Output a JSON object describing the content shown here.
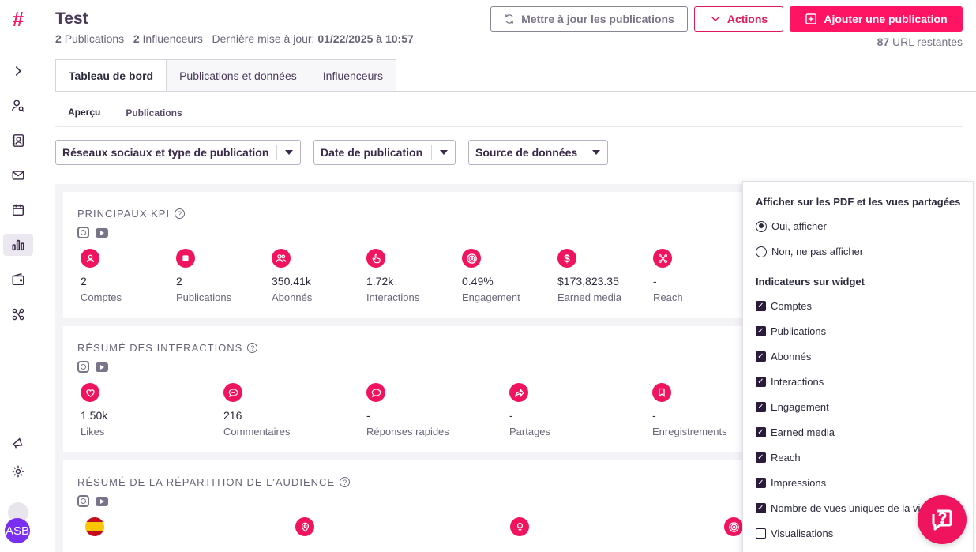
{
  "app": {
    "logo_glyph": "#",
    "brand_color": "#ff1464"
  },
  "sidebar": {
    "items": [
      {
        "name": "expand-icon"
      },
      {
        "name": "user-search-icon"
      },
      {
        "name": "contacts-icon"
      },
      {
        "name": "mail-icon"
      },
      {
        "name": "calendar-icon"
      },
      {
        "name": "bar-chart-icon",
        "active": true
      },
      {
        "name": "wallet-icon"
      },
      {
        "name": "network-icon"
      },
      {
        "name": "megaphone-icon"
      },
      {
        "name": "settings-icon"
      }
    ],
    "avatar_initials": "ASB"
  },
  "header": {
    "title": "Test",
    "publications_count": "2",
    "publications_label": "Publications",
    "influencers_count": "2",
    "influencers_label": "Influenceurs",
    "last_update_label": "Dernière mise à jour:",
    "last_update_value": "01/22/2025 à 10:57",
    "update_button": "Mettre à jour les publications",
    "actions_button": "Actions",
    "add_button": "Ajouter une publication",
    "urls_left_count": "87",
    "urls_left_label": "URL restantes"
  },
  "tabs": [
    {
      "label": "Tableau de bord",
      "active": true
    },
    {
      "label": "Publications et données"
    },
    {
      "label": "Influenceurs"
    }
  ],
  "subtabs": [
    {
      "label": "Aperçu",
      "active": true
    },
    {
      "label": "Publications"
    }
  ],
  "filters": [
    {
      "label": "Réseaux sociaux et type de publication"
    },
    {
      "label": "Date de publication"
    },
    {
      "label": "Source de données"
    }
  ],
  "kpi_card": {
    "title": "PRINCIPAUX KPI",
    "metrics": [
      {
        "icon": "user-icon",
        "value": "2",
        "label": "Comptes"
      },
      {
        "icon": "square-icon",
        "value": "2",
        "label": "Publications"
      },
      {
        "icon": "users-icon",
        "value": "350.41k",
        "label": "Abonnés"
      },
      {
        "icon": "hand-pointer-icon",
        "value": "1.72k",
        "label": "Interactions"
      },
      {
        "icon": "target-icon",
        "value": "0.49%",
        "label": "Engagement"
      },
      {
        "icon": "dollar-icon",
        "value": "$173,823.35",
        "label": "Earned media"
      },
      {
        "icon": "reach-icon",
        "value": "-",
        "label": "Reach"
      }
    ]
  },
  "interactions_card": {
    "title": "RÉSUMÉ DES INTERACTIONS",
    "metrics": [
      {
        "icon": "heart-icon",
        "value": "1.50k",
        "label": "Likes"
      },
      {
        "icon": "comment-icon",
        "value": "216",
        "label": "Commentaires"
      },
      {
        "icon": "quick-reply-icon",
        "value": "-",
        "label": "Réponses rapides"
      },
      {
        "icon": "share-icon",
        "value": "-",
        "label": "Partages"
      },
      {
        "icon": "bookmark-icon",
        "value": "-",
        "label": "Enregistrements"
      }
    ]
  },
  "audience_card": {
    "title": "RÉSUMÉ DE LA RÉPARTITION DE L'AUDIENCE",
    "icons": [
      "spain-flag-icon",
      "location-pin-icon",
      "gender-female-icon",
      "target-icon"
    ]
  },
  "panel": {
    "pdf_heading": "Afficher sur les PDF et les vues partagées",
    "radio_yes": "Oui, afficher",
    "radio_no": "Non, ne pas afficher",
    "indicators_heading": "Indicateurs sur widget",
    "indicators": [
      {
        "label": "Comptes",
        "checked": true
      },
      {
        "label": "Publications",
        "checked": true
      },
      {
        "label": "Abonnés",
        "checked": true
      },
      {
        "label": "Interactions",
        "checked": true
      },
      {
        "label": "Engagement",
        "checked": true
      },
      {
        "label": "Earned media",
        "checked": true
      },
      {
        "label": "Reach",
        "checked": true
      },
      {
        "label": "Impressions",
        "checked": true
      },
      {
        "label": "Nombre de vues uniques de la vi",
        "checked": true
      },
      {
        "label": "Visualisations",
        "checked": false
      }
    ]
  }
}
